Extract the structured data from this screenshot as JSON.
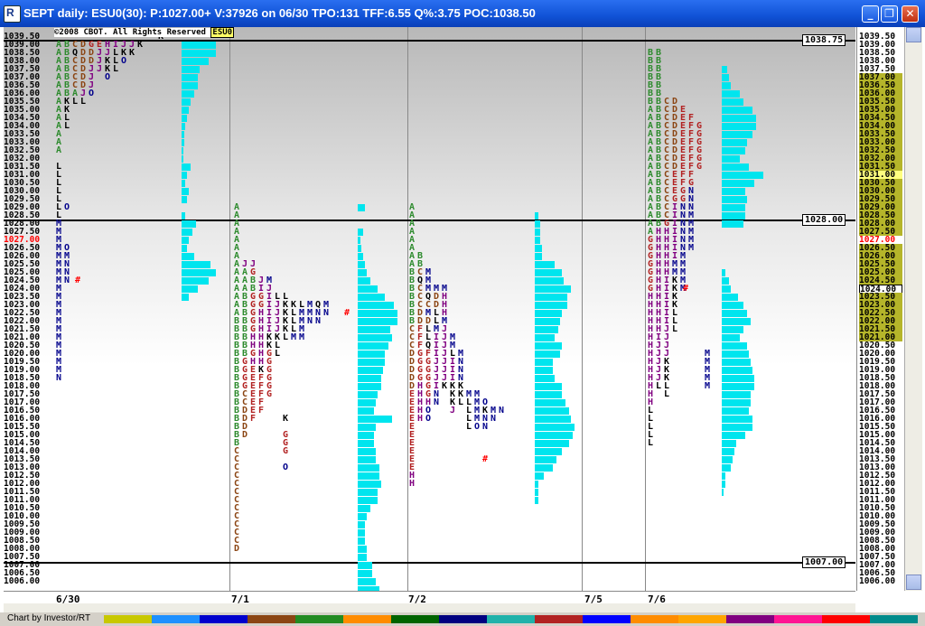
{
  "window": {
    "title": "SEPT daily: ESU0(30): P:1027.00+ V:37926 on 06/30 TPO:131 TFF:6.55 Q%:3.75 POC:1038.50",
    "icon_glyph": "R",
    "min_glyph": "_",
    "max_glyph": "❐",
    "close_glyph": "✕"
  },
  "chart_header": {
    "copyright": "©2008 CBOT. All Rights Reserved",
    "symbol": "ESU0"
  },
  "price_axis": {
    "labels": [
      "1039.50",
      "1039.00",
      "1038.50",
      "1038.00",
      "1037.50",
      "1037.00",
      "1036.50",
      "1036.00",
      "1035.50",
      "1035.00",
      "1034.50",
      "1034.00",
      "1033.50",
      "1033.00",
      "1032.50",
      "1032.00",
      "1031.50",
      "1031.00",
      "1030.50",
      "1030.00",
      "1029.50",
      "1029.00",
      "1028.50",
      "1028.00",
      "1027.50",
      "1027.00",
      "1026.50",
      "1026.00",
      "1025.50",
      "1025.00",
      "1024.50",
      "1024.00",
      "1023.50",
      "1023.00",
      "1022.50",
      "1022.00",
      "1021.50",
      "1021.00",
      "1020.50",
      "1020.00",
      "1019.50",
      "1019.00",
      "1018.50",
      "1018.00",
      "1017.50",
      "1017.00",
      "1016.50",
      "1016.00",
      "1015.50",
      "1015.00",
      "1014.50",
      "1014.00",
      "1013.50",
      "1013.00",
      "1012.50",
      "1012.00",
      "1011.50",
      "1011.00",
      "1010.50",
      "1010.00",
      "1009.50",
      "1009.00",
      "1008.50",
      "1008.00",
      "1007.50",
      "1007.00",
      "1006.50",
      "1006.00"
    ],
    "current_price": "1027.00",
    "highlight_price": "1024.00",
    "value_area_high": "1037.00",
    "value_area_low": "1021.00",
    "highlight_color": "#b5b52a",
    "current_color": "#ff0000"
  },
  "reference_lines": [
    {
      "label": "1038.75"
    },
    {
      "label": "1028.00"
    },
    {
      "label": "1007.00"
    }
  ],
  "dates": [
    "6/30",
    "7/1",
    "7/2",
    "7/5",
    "7/6"
  ],
  "profiles": [
    {
      "name": "6/30"
    },
    {
      "name": "7/1"
    },
    {
      "name": "7/2"
    },
    {
      "name": "7/6"
    }
  ],
  "status": {
    "text": "Chart by Investor/RT"
  },
  "colors": {
    "histogram": "#00e5ee",
    "period_A": "#2e8b2e",
    "period_B": "#2e8b2e",
    "period_C": "#8b4513",
    "period_D": "#8b4513",
    "period_E": "#b22222",
    "period_F": "#b22222",
    "period_G": "#b22222",
    "period_H": "#800080",
    "period_I": "#800080",
    "period_J": "#800080",
    "period_K": "#000000",
    "period_L": "#000000",
    "period_M": "#00008b",
    "period_N": "#00008b",
    "period_O": "#00008b",
    "period_Q": "#000000"
  }
}
